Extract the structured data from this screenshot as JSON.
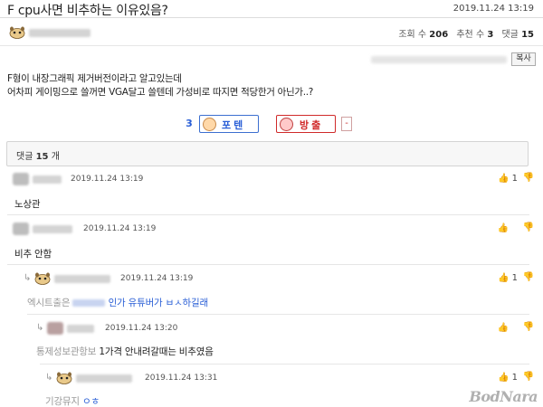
{
  "post": {
    "title": "F cpu사면 비추하는 이유있음?",
    "date": "2019.11.24 13:19",
    "stats": {
      "views_label": "조회 수",
      "views": "206",
      "recommends_label": "추천 수",
      "recommends": "3",
      "comments_label": "댓글",
      "comments": "15"
    },
    "copy_label": "복사",
    "body_line1": "F형이 내장그래픽 제거버전이라고 알고있는데",
    "body_line2": "어차피 게이밍으로 쓸꺼면 VGA달고 쓸텐데 가성비로 따지면 적당한거 아닌가..?"
  },
  "votes": {
    "count": "3",
    "up_label": "포텐",
    "down_label": "방출",
    "minus": "-"
  },
  "comment_header": {
    "label": "댓글",
    "count": "15",
    "unit": "개"
  },
  "comments": [
    {
      "date": "2019.11.24 13:19",
      "text": "노상관",
      "likes": "1"
    },
    {
      "date": "2019.11.24 13:19",
      "text": "비추 안함",
      "likes": "0"
    },
    {
      "date": "2019.11.24 13:19",
      "text_prefix": "엑시트출은",
      "text_suffix": "인가 유튜버가 ㅂㅅ하길래",
      "likes": "1"
    },
    {
      "date": "2019.11.24 13:20",
      "text_prefix": "통제성보관항보",
      "text_suffix": "1가격 안내려갈때는 비추였음",
      "likes": "0"
    },
    {
      "date": "2019.11.24 13:31",
      "text_prefix": "기강뮤지",
      "text_suffix": "ㅇㅎ",
      "likes": "1"
    }
  ],
  "icons": {
    "like": "thumbs-up-icon",
    "dislike": "thumbs-down-icon",
    "reply": "reply-arrow-icon"
  },
  "watermark": "BodNara"
}
